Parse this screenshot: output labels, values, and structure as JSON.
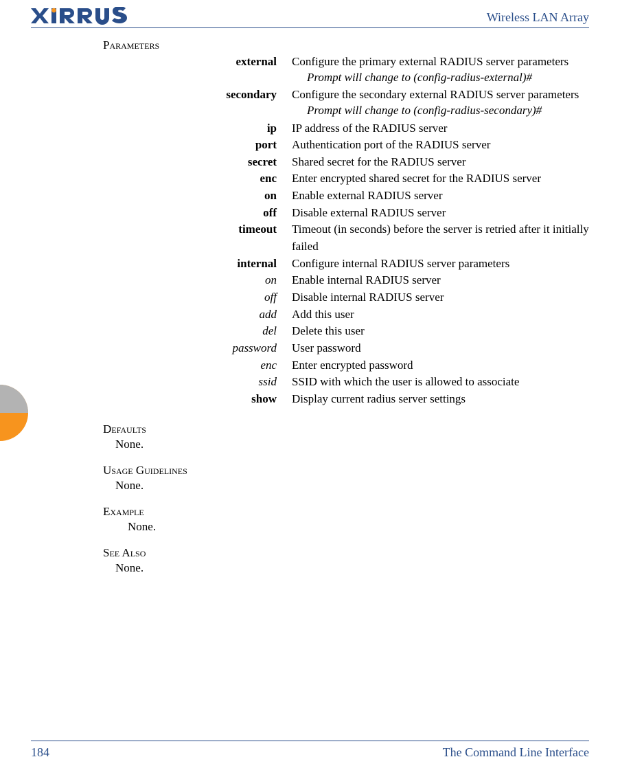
{
  "header": {
    "brand": "XIRRUS",
    "title": "Wireless LAN Array"
  },
  "sections": {
    "parameters_heading": "Parameters",
    "defaults_heading": "Defaults",
    "defaults_body": "None.",
    "usage_heading": "Usage Guidelines",
    "usage_body": "None.",
    "example_heading": "Example",
    "example_body": "None.",
    "seealso_heading": "See Also",
    "seealso_body": "None."
  },
  "parameters": [
    {
      "term": "external",
      "style": "bold",
      "desc": "Configure the primary external RADIUS server parameters",
      "prompt": "Prompt will change to (config-radius-external)#"
    },
    {
      "term": "secondary",
      "style": "bold",
      "desc": "Configure the secondary external RADIUS server parameters",
      "prompt": "Prompt will change to (config-radius-secondary)#"
    },
    {
      "term": "ip",
      "style": "bold",
      "desc": "IP address of the RADIUS server"
    },
    {
      "term": "port",
      "style": "bold",
      "desc": "Authentication port of the RADIUS server"
    },
    {
      "term": "secret",
      "style": "bold",
      "desc": "Shared secret for the RADIUS server"
    },
    {
      "term": "enc",
      "style": "bold",
      "desc": "Enter encrypted shared secret for the RADIUS server"
    },
    {
      "term": "on",
      "style": "bold",
      "desc": "Enable external RADIUS server"
    },
    {
      "term": "off",
      "style": "bold",
      "desc": "Disable external RADIUS server"
    },
    {
      "term": "timeout",
      "style": "bold",
      "desc": "Timeout (in seconds) before the server is retried after it initially failed"
    },
    {
      "term": "internal",
      "style": "bold",
      "desc": "Configure internal RADIUS server parameters"
    },
    {
      "term": "on",
      "style": "italic",
      "desc": "Enable internal RADIUS server"
    },
    {
      "term": "off",
      "style": "italic",
      "desc": "Disable internal RADIUS server"
    },
    {
      "term": "add",
      "style": "italic",
      "desc": "Add this user"
    },
    {
      "term": "del",
      "style": "italic",
      "desc": "Delete this user"
    },
    {
      "term": "password",
      "style": "italic",
      "desc": "User password"
    },
    {
      "term": "enc",
      "style": "italic",
      "desc": "Enter encrypted password"
    },
    {
      "term": "ssid",
      "style": "italic",
      "desc": "SSID with which the user is allowed to associate"
    },
    {
      "term": "show",
      "style": "bold",
      "desc": "Display current radius server settings"
    }
  ],
  "footer": {
    "page_number": "184",
    "section_title": "The Command Line Interface"
  }
}
